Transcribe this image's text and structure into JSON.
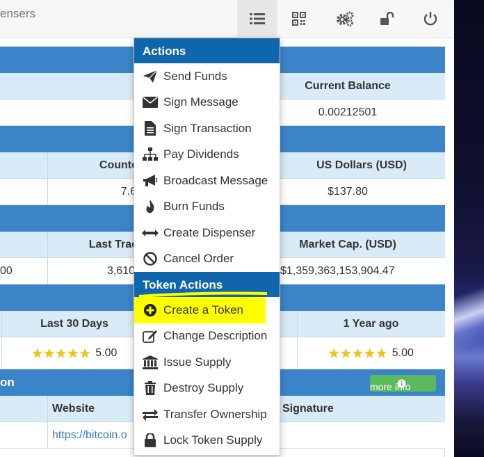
{
  "topbar": {
    "brand_fragment": "ensers",
    "icons": [
      "list-icon",
      "qrcode-icon",
      "gears-icon",
      "unlock-icon",
      "power-icon"
    ]
  },
  "balance_section": {
    "header": "Current Balance",
    "value": "0.00212501"
  },
  "price_section": {
    "header_counter": "Counte",
    "header_usd": "US Dollars (USD)",
    "value_counter": "7.6",
    "value_usd": "$137.80"
  },
  "market_section": {
    "header_last_trade": "Last Trac",
    "header_market_cap": "Market Cap. (USD)",
    "value_left": "00",
    "value_last_trade": "3,610",
    "value_market_cap": "$1,359,363,153,904.47"
  },
  "rating_section": {
    "header_30_days": "Last 30 Days",
    "header_1_year": "1 Year ago",
    "score_30_days": "5.00",
    "score_1_year": "5.00",
    "stars": "★★★★★"
  },
  "info_section": {
    "title_fragment": "on",
    "more_info_label": "more info",
    "header_website": "Website",
    "header_signature": "Signature",
    "website_value": "https://bitcoin.o"
  },
  "dropdown": {
    "actions_title": "Actions",
    "actions": [
      {
        "label": "Send Funds",
        "icon": "paper-plane-icon"
      },
      {
        "label": "Sign Message",
        "icon": "envelope-icon"
      },
      {
        "label": "Sign Transaction",
        "icon": "file-text-icon"
      },
      {
        "label": "Pay Dividends",
        "icon": "sitemap-icon"
      },
      {
        "label": "Broadcast Message",
        "icon": "bullhorn-icon"
      },
      {
        "label": "Burn Funds",
        "icon": "fire-icon"
      },
      {
        "label": "Create Dispenser",
        "icon": "arrows-h-icon"
      },
      {
        "label": "Cancel Order",
        "icon": "ban-icon"
      }
    ],
    "token_actions_title": "Token Actions",
    "token_actions": [
      {
        "label": "Create a Token",
        "icon": "plus-circle-icon"
      },
      {
        "label": "Change Description",
        "icon": "edit-icon"
      },
      {
        "label": "Issue Supply",
        "icon": "bank-icon"
      },
      {
        "label": "Destroy Supply",
        "icon": "trash-icon"
      },
      {
        "label": "Transfer Ownership",
        "icon": "exchange-icon"
      },
      {
        "label": "Lock Token Supply",
        "icon": "lock-icon"
      }
    ],
    "highlight_color": "#ffff00",
    "header_color": "#0f66ad"
  }
}
